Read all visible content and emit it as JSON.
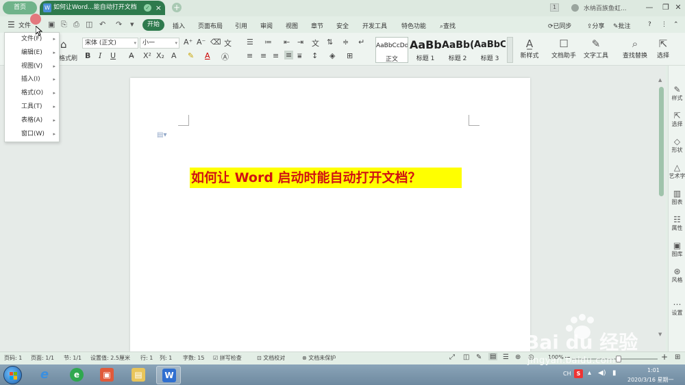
{
  "titlebar": {
    "home_tab": "首页",
    "doc_tab": "如何让Word...能自动打开文档",
    "badge_count": "1",
    "user_name": "水纳百族鱼虹...",
    "min": "—",
    "restore": "❐",
    "close": "✕"
  },
  "menubar": {
    "file_label": "文件",
    "tabs": [
      "开始",
      "插入",
      "页面布局",
      "引用",
      "审阅",
      "视图",
      "章节",
      "安全",
      "开发工具",
      "特色功能"
    ],
    "search": "查找",
    "sync": "已同步",
    "share": "分享",
    "comment": "批注",
    "help": "?"
  },
  "ribbon": {
    "format_painter": "格式刷",
    "font_name": "宋体 (正文)",
    "font_size": "小一",
    "styles": [
      {
        "preview": "AaBbCcDd",
        "label": "正文"
      },
      {
        "preview": "AaBb",
        "label": "标题 1"
      },
      {
        "preview": "AaBb(",
        "label": "标题 2"
      },
      {
        "preview": "AaBbC(",
        "label": "标题 3"
      }
    ],
    "new_style": "新样式",
    "doc_assistant": "文档助手",
    "text_tools": "文字工具",
    "find_replace": "查找替换",
    "select": "选择"
  },
  "file_menu": {
    "items": [
      "文件(F)",
      "编辑(E)",
      "视图(V)",
      "插入(I)",
      "格式(O)",
      "工具(T)",
      "表格(A)",
      "窗口(W)"
    ]
  },
  "document": {
    "heading": "如何让 Word 启动时能自动打开文档？",
    "heading_color": "#d01212",
    "highlight_color": "#ffff00"
  },
  "side_panel": {
    "items": [
      "样式",
      "选择",
      "形状",
      "艺术字",
      "图表",
      "属性",
      "图库",
      "风格",
      "设置"
    ]
  },
  "statusbar": {
    "page": "页码: 1",
    "pages": "页面: 1/1",
    "section": "节: 1/1",
    "set_value": "设置值: 2.5厘米",
    "row": "行: 1",
    "col": "列: 1",
    "word_count": "字数: 15",
    "spell_check": "拼写检查",
    "doc_check": "文档校对",
    "unprotected": "文档未保护",
    "zoom": "100%",
    "zoom_level": 0.54
  },
  "taskbar": {
    "ime": "CH",
    "time": "1:01",
    "date": "2020/3/16 星期一"
  },
  "watermark": {
    "logo_text": "Bai du 经验",
    "url": "jingyan.baidu.com"
  }
}
